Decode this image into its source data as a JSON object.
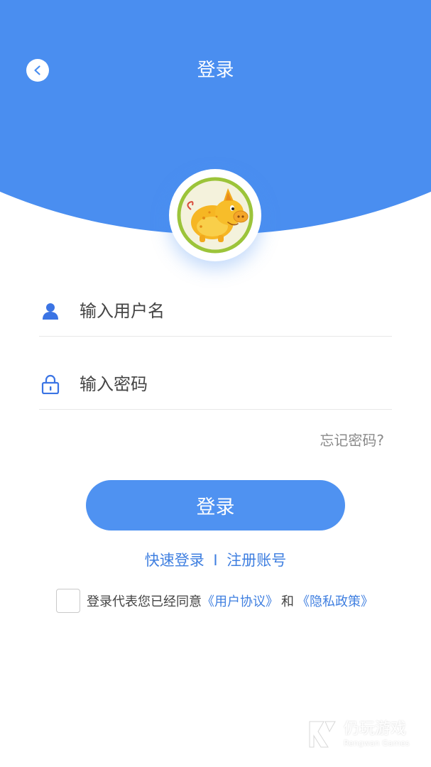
{
  "header": {
    "title": "登录",
    "back_icon": "chevron-left-icon",
    "background_color": "#4a8ef0"
  },
  "avatar": {
    "icon": "pig-mascot-logo"
  },
  "form": {
    "username_placeholder": "输入用户名",
    "username_icon": "user-icon",
    "password_placeholder": "输入密码",
    "password_icon": "lock-icon",
    "forgot_label": "忘记密码?"
  },
  "login_button": {
    "label": "登录",
    "color": "#4f92f1"
  },
  "links": {
    "quick_login": "快速登录",
    "separator": "I",
    "register": "注册账号"
  },
  "agreement": {
    "prefix": "登录代表您已经同意",
    "user_agreement": "《用户协议》",
    "and": "和",
    "privacy_policy": "《隐私政策》",
    "checked": false
  },
  "watermark": {
    "name_cn": "仍玩游戏",
    "name_en": "Rengwan Games"
  }
}
